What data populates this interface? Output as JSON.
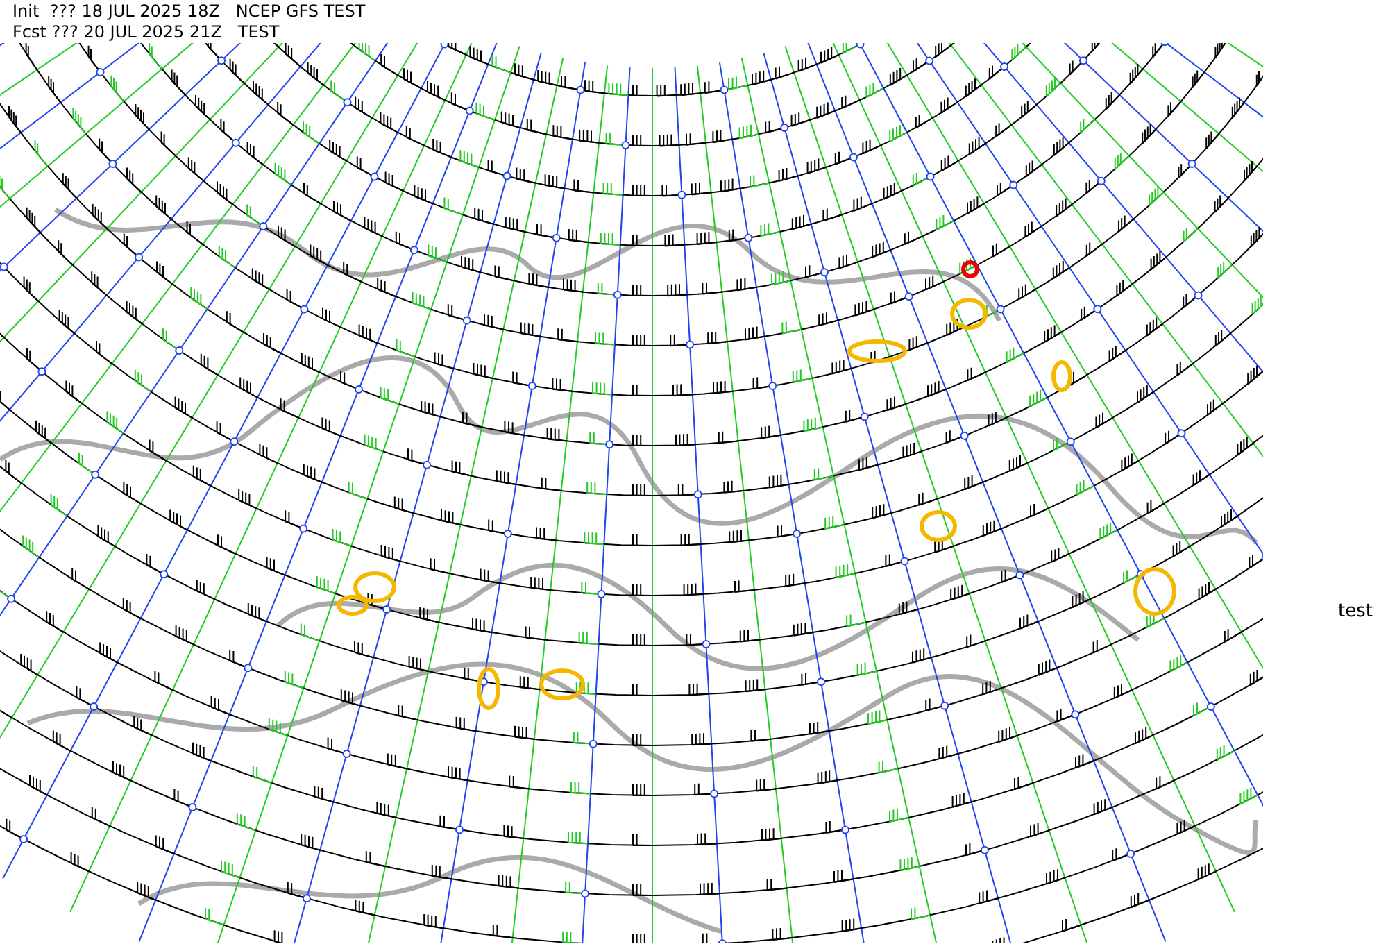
{
  "header": {
    "init_line": "Init  ??? 18 JUL 2025 18Z   NCEP GFS TEST",
    "forecast_line": "Fcst ??? 20 JUL 2025 21Z   TEST"
  },
  "side_label": "test"
}
